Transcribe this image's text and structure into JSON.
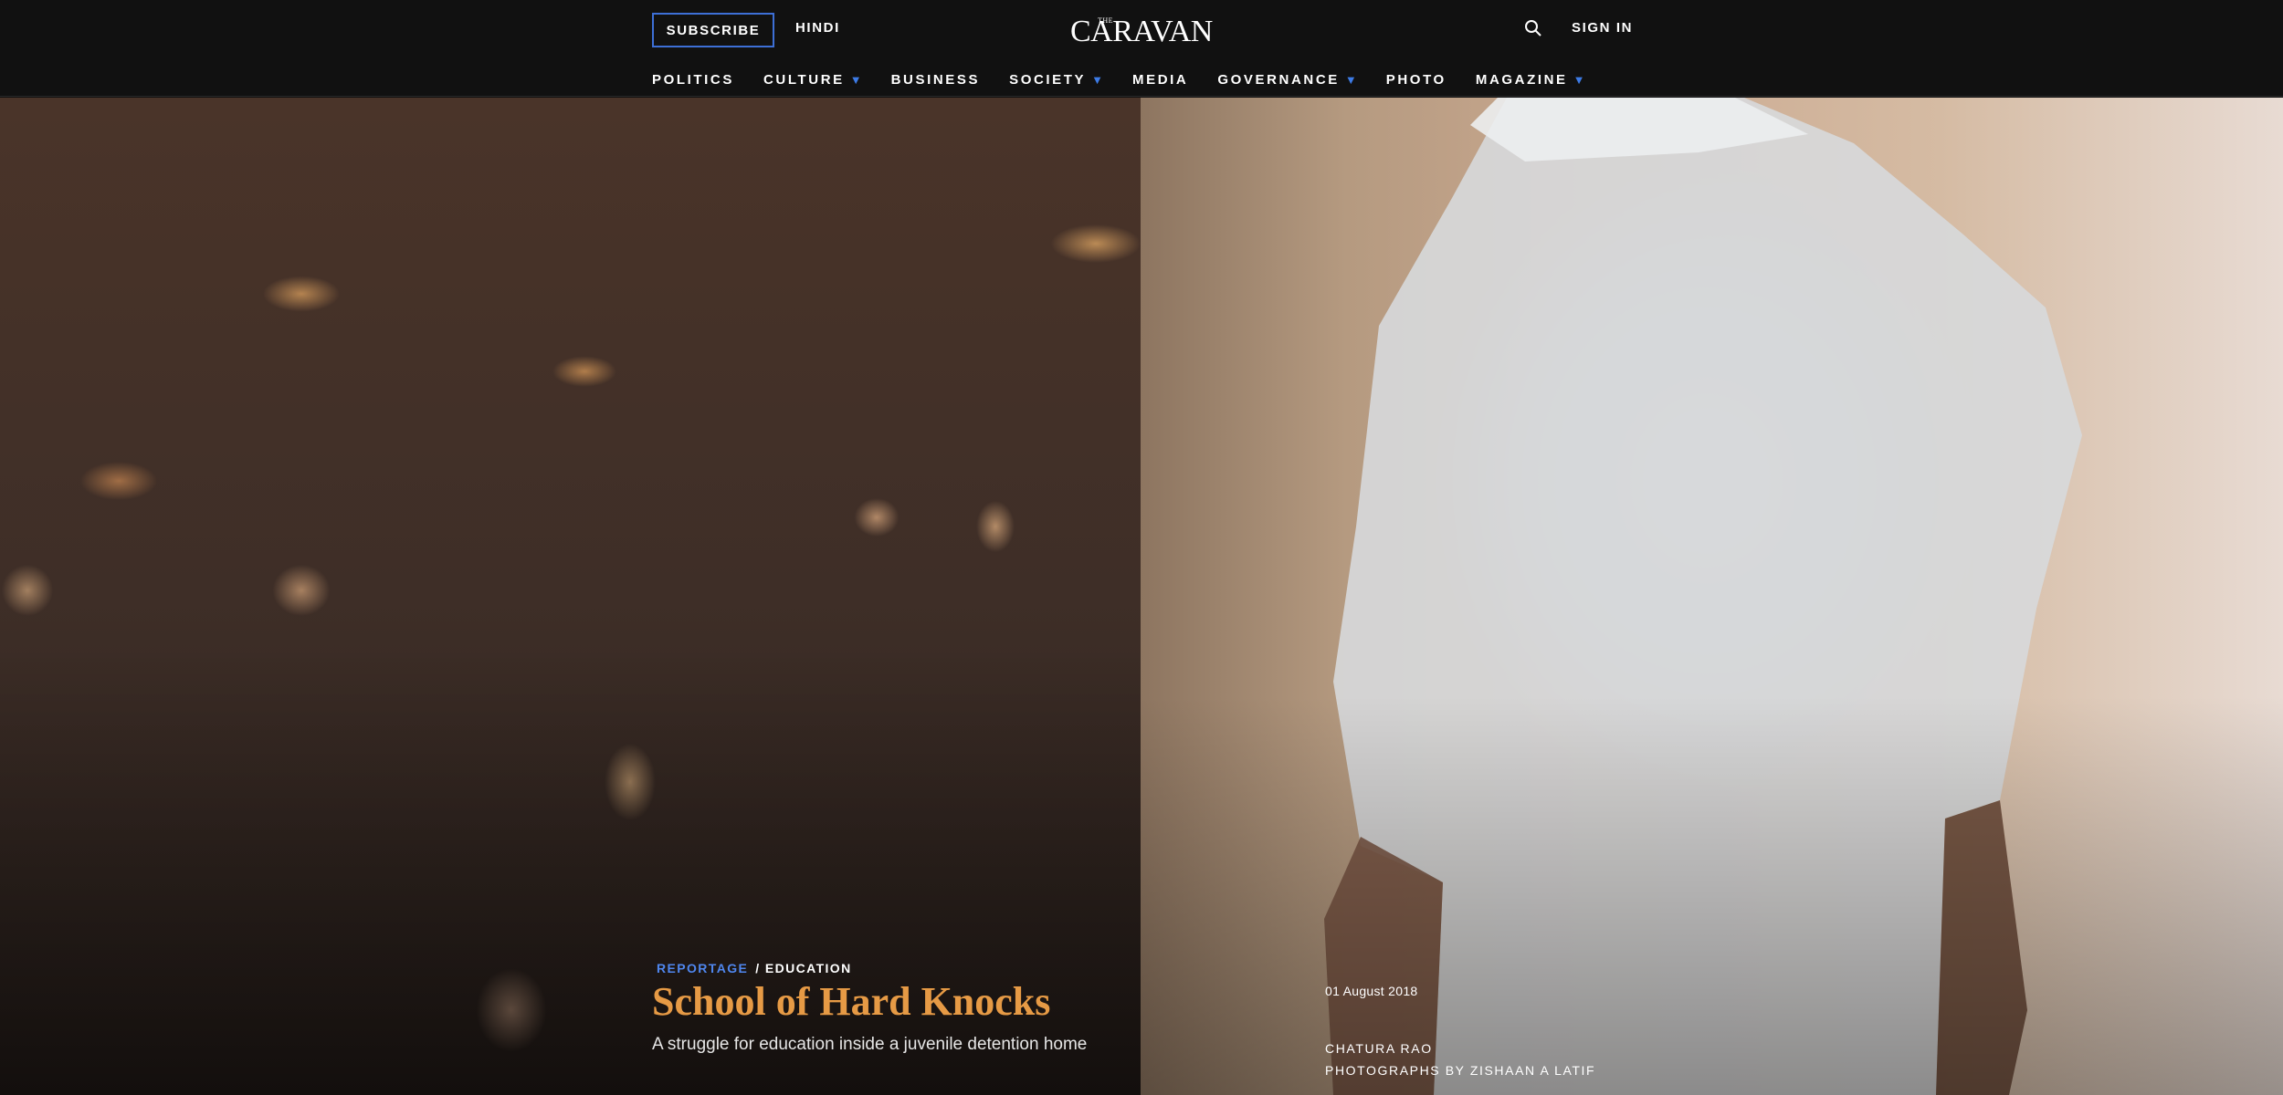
{
  "header": {
    "subscribe_label": "SUBSCRIBE",
    "hindi_label": "HINDI",
    "logo_small": "THE",
    "logo_main": "CARAVAN",
    "search_icon": "search-icon",
    "signin_label": "SIGN IN"
  },
  "nav": {
    "items": [
      {
        "label": "POLITICS",
        "has_dropdown": false
      },
      {
        "label": "CULTURE",
        "has_dropdown": true
      },
      {
        "label": "BUSINESS",
        "has_dropdown": false
      },
      {
        "label": "SOCIETY",
        "has_dropdown": true
      },
      {
        "label": "MEDIA",
        "has_dropdown": false
      },
      {
        "label": "GOVERNANCE",
        "has_dropdown": true
      },
      {
        "label": "PHOTO",
        "has_dropdown": false
      },
      {
        "label": "MAGAZINE",
        "has_dropdown": true
      }
    ],
    "dropdown_glyph": "▼"
  },
  "article": {
    "category": "REPORTAGE",
    "subcategory": "/ EDUCATION",
    "title": "School of Hard Knocks",
    "dek": "A struggle for education inside a juvenile detention home",
    "date": "01 August 2018",
    "author": "CHATURA RAO",
    "photo_credit": "PHOTOGRAPHS BY ZISHAAN A LATIF"
  },
  "colors": {
    "accent_blue": "#3d6fd6",
    "headline_orange": "#e69a45",
    "header_bg": "#111111"
  }
}
